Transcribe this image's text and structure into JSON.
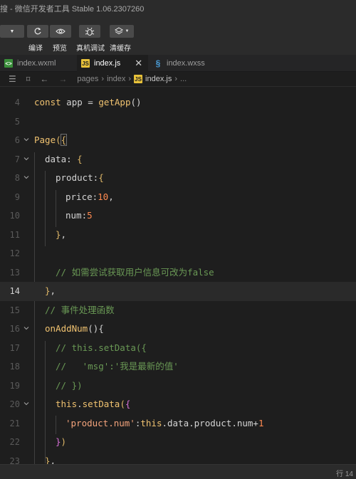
{
  "window": {
    "title": "搜 - 微信开发者工具 Stable 1.06.2307260"
  },
  "toolbar": {
    "compile_label": "编译",
    "preview_label": "预览",
    "device_debug_label": "真机调试",
    "clear_cache_label": "清缓存"
  },
  "tabs": [
    {
      "label": "index.wxml",
      "icon": "wxml-file-icon",
      "active": false
    },
    {
      "label": "index.js",
      "icon": "js-file-icon",
      "active": true
    },
    {
      "label": "index.wxss",
      "icon": "wxss-file-icon",
      "active": false
    }
  ],
  "breadcrumb": {
    "parts": [
      "pages",
      "index",
      "index.js",
      "..."
    ]
  },
  "editor": {
    "current_line": "14",
    "lines": [
      {
        "n": "4",
        "text": "const app = getApp()"
      },
      {
        "n": "5",
        "text": ""
      },
      {
        "n": "6",
        "text": "Page({"
      },
      {
        "n": "7",
        "text": "data: {"
      },
      {
        "n": "8",
        "text": "product:{"
      },
      {
        "n": "9",
        "text": "price:10,"
      },
      {
        "n": "10",
        "text": "num:5"
      },
      {
        "n": "11",
        "text": "},"
      },
      {
        "n": "12",
        "text": ""
      },
      {
        "n": "13",
        "text": "// 如需尝试获取用户信息可改为false"
      },
      {
        "n": "14",
        "text": "},"
      },
      {
        "n": "15",
        "text": "// 事件处理函数"
      },
      {
        "n": "16",
        "text": "onAddNum(){"
      },
      {
        "n": "17",
        "text": "// this.setData({"
      },
      {
        "n": "18",
        "text": "//   'msg':'我是最新的值'"
      },
      {
        "n": "19",
        "text": "// })"
      },
      {
        "n": "20",
        "text": "this.setData({"
      },
      {
        "n": "21",
        "text": "'product.num':this.data.product.num+1"
      },
      {
        "n": "22",
        "text": "})"
      },
      {
        "n": "23",
        "text": "},"
      }
    ]
  },
  "status": {
    "text": "行 14"
  },
  "colors": {
    "background": "#1e1e1e",
    "keyword": "#f0c270",
    "number": "#ff8a50",
    "string": "#f4a47c",
    "comment": "#6a9955"
  }
}
